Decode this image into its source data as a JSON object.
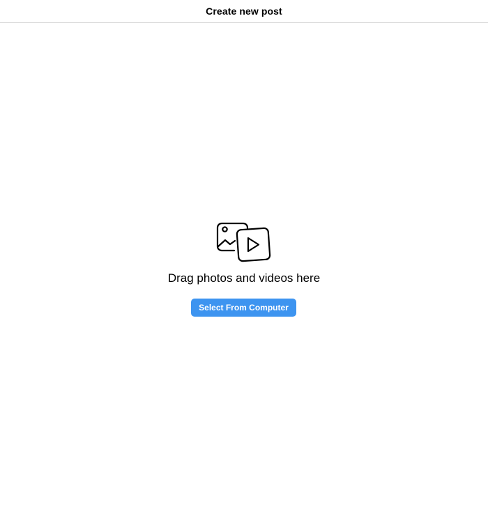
{
  "header": {
    "title": "Create new post"
  },
  "drop_zone": {
    "icon": "photo-and-video-icon",
    "message": "Drag photos and videos here",
    "button_label": "Select From Computer"
  },
  "colors": {
    "accent": "#3d94f0",
    "divider": "#dbdbdb"
  }
}
